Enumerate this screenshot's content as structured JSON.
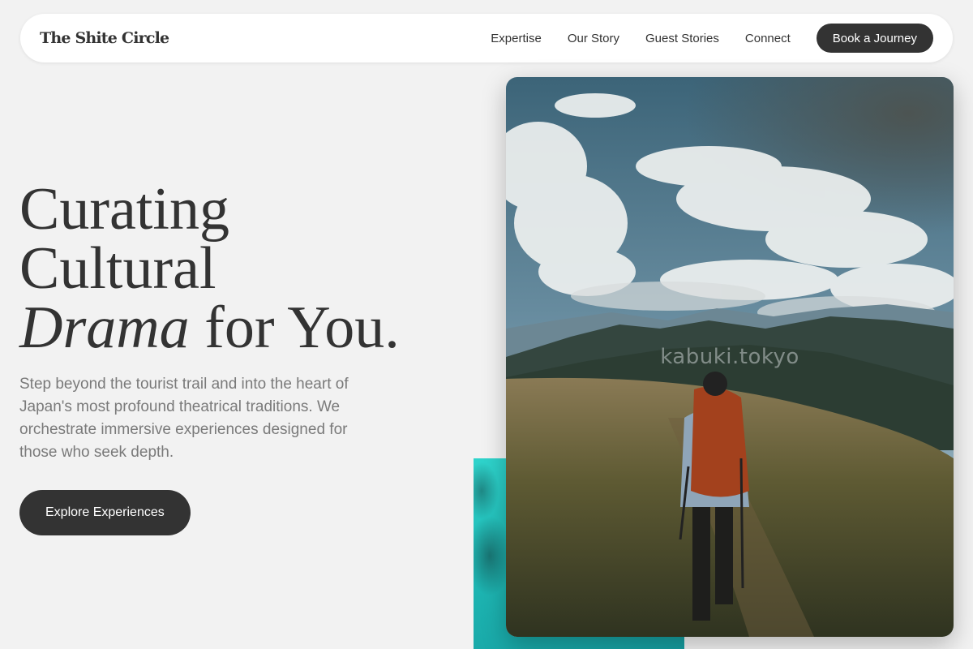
{
  "nav": {
    "brand": "The Shite Circle",
    "links": [
      "Expertise",
      "Our Story",
      "Guest Stories",
      "Connect"
    ],
    "cta_label": "Book a Journey"
  },
  "hero": {
    "headline_line1": "Curating",
    "headline_line2": "Cultural",
    "headline_italic": "Drama",
    "headline_rest": "for You.",
    "lead": "Step beyond the tourist trail and into the heart of Japan's most profound theatrical traditions. We orchestrate immersive experiences designed for those who seek depth.",
    "cta_label": "Explore Experiences"
  },
  "images": {
    "main_watermark": "kabuki.tokyo"
  },
  "colors": {
    "background": "#f2f2f2",
    "button": "#333333",
    "text": "#333333",
    "muted_text": "#7a7a7a",
    "sea_accent": "#1fb9b5"
  }
}
